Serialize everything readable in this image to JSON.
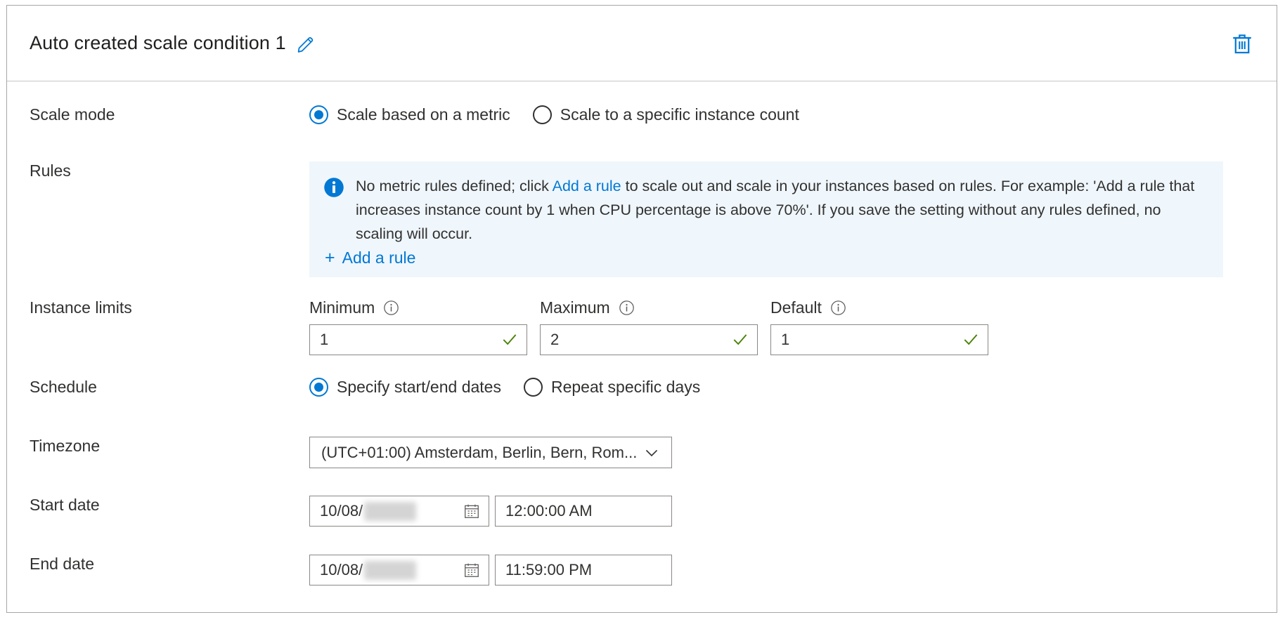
{
  "header": {
    "title": "Auto created scale condition 1",
    "edit_icon": "pencil-icon",
    "delete_icon": "trash-icon"
  },
  "scale_mode": {
    "label": "Scale mode",
    "options": [
      {
        "label": "Scale based on a metric",
        "selected": true
      },
      {
        "label": "Scale to a specific instance count",
        "selected": false
      }
    ]
  },
  "rules": {
    "label": "Rules",
    "info_icon": "info-circle-icon",
    "message_part1": "No metric rules defined; click ",
    "message_link": "Add a rule",
    "message_part2": " to scale out and scale in your instances based on rules. For example: 'Add a rule that increases instance count by 1 when CPU percentage is above 70%'. If you save the setting without any rules defined, no scaling will occur.",
    "add_rule_plus": "+",
    "add_rule_label": "Add a rule"
  },
  "instance_limits": {
    "label": "Instance limits",
    "fields": [
      {
        "label": "Minimum",
        "value": "1",
        "valid": true,
        "info_icon": "info-icon"
      },
      {
        "label": "Maximum",
        "value": "2",
        "valid": true,
        "info_icon": "info-icon"
      },
      {
        "label": "Default",
        "value": "1",
        "valid": true,
        "info_icon": "info-icon"
      }
    ]
  },
  "schedule": {
    "label": "Schedule",
    "options": [
      {
        "label": "Specify start/end dates",
        "selected": true
      },
      {
        "label": "Repeat specific days",
        "selected": false
      }
    ]
  },
  "timezone": {
    "label": "Timezone",
    "value": "(UTC+01:00) Amsterdam, Berlin, Bern, Rom...",
    "chevron_icon": "chevron-down-icon"
  },
  "start_date": {
    "label": "Start date",
    "date_value": "10/08/",
    "date_redacted": true,
    "calendar_icon": "calendar-icon",
    "time_value": "12:00:00 AM"
  },
  "end_date": {
    "label": "End date",
    "date_value": "10/08/",
    "date_redacted": true,
    "calendar_icon": "calendar-icon",
    "time_value": "11:59:00 PM"
  },
  "colors": {
    "accent": "#0078d4",
    "banner_bg": "#eff6fc",
    "valid_check": "#498205",
    "border": "#8a8886"
  }
}
